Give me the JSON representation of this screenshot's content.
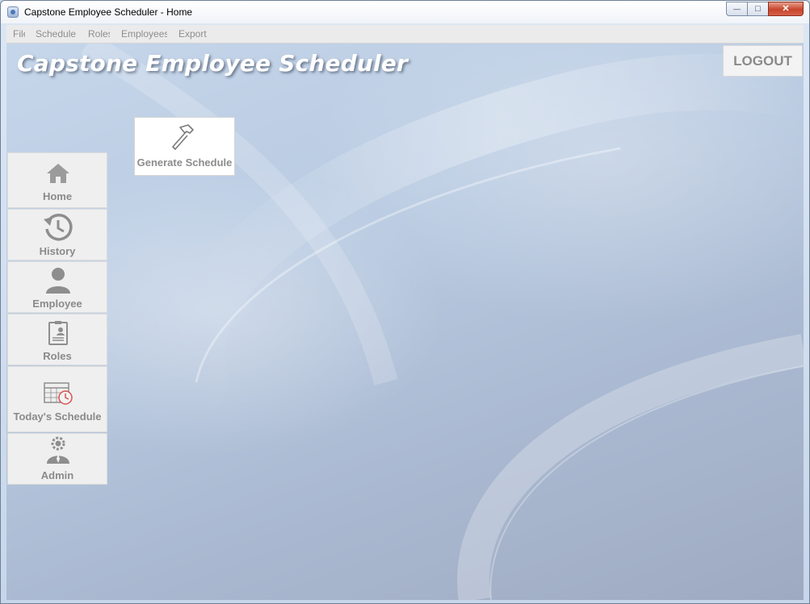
{
  "window": {
    "title": "Capstone Employee Scheduler - Home",
    "controls": {
      "minimize": "—",
      "maximize": "□",
      "close": "✕"
    }
  },
  "menu": [
    {
      "label": "File"
    },
    {
      "label": "Schedule"
    },
    {
      "label": "Roles"
    },
    {
      "label": "Employees"
    },
    {
      "label": "Export"
    }
  ],
  "header": {
    "title": "Capstone Employee Scheduler",
    "logout_label": "LOGOUT"
  },
  "actions": {
    "generate_schedule": {
      "label": "Generate Schedule",
      "icon": "hammer-icon"
    }
  },
  "sidebar": {
    "items": [
      {
        "label": "Home",
        "icon": "home-icon",
        "selected": true
      },
      {
        "label": "History",
        "icon": "history-icon"
      },
      {
        "label": "Employee",
        "icon": "user-icon"
      },
      {
        "label": "Roles",
        "icon": "id-card-icon"
      },
      {
        "label": "Today's Schedule",
        "icon": "calendar-clock-icon"
      },
      {
        "label": "Admin",
        "icon": "admin-icon"
      }
    ]
  },
  "colors": {
    "title_text": "#ffffff",
    "button_text": "#8a8a8a",
    "background": "#b9cbe2",
    "close_button": "#c6452c"
  }
}
